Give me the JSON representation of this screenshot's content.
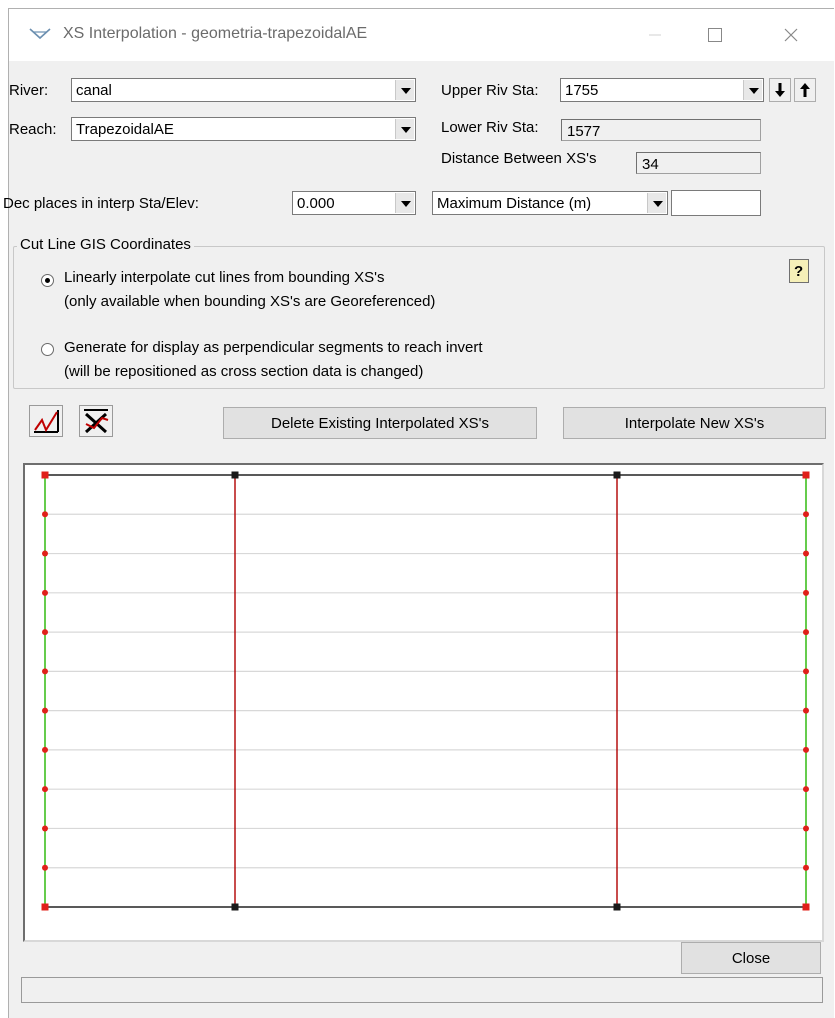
{
  "window": {
    "title": "XS Interpolation  - geometria-trapezoidalAE"
  },
  "river": {
    "label": "River:",
    "value": "canal"
  },
  "reach": {
    "label": "Reach:",
    "value": "TrapezoidalAE"
  },
  "upper_riv_sta": {
    "label": "Upper Riv Sta:",
    "value": "1755"
  },
  "lower_riv_sta": {
    "label": "Lower Riv Sta:",
    "value": "1577"
  },
  "distance_between": {
    "label": "Distance Between XS's",
    "value": "34"
  },
  "dec_places": {
    "label": "Dec places in interp Sta/Elev:",
    "value": "0.000"
  },
  "max_distance": {
    "selected": "Maximum Distance (m)",
    "value": ""
  },
  "cutline_group": {
    "legend": "Cut Line GIS Coordinates",
    "option1_line1": "Linearly interpolate cut lines from bounding XS's",
    "option1_line2": "(only available when bounding XS's are Georeferenced)",
    "option2_line1": "Generate for display as perpendicular segments to reach invert",
    "option2_line2": "(will be repositioned as cross section data is changed)",
    "selected_option": 1
  },
  "buttons": {
    "delete_existing": "Delete Existing Interpolated XS's",
    "interpolate_new": "Interpolate New XS's",
    "close": "Close"
  },
  "icons": {
    "help": "help-icon",
    "draw_line": "draw-line-icon",
    "delete_line": "delete-line-icon",
    "down": "arrow-down-icon",
    "up": "arrow-up-icon"
  },
  "colors": {
    "bank_line": "#3fbf1f",
    "channel_line": "#b00000",
    "node_red": "#e0201a",
    "node_black": "#1a1a1a",
    "xs_line": "#d8d8d8"
  },
  "plot": {
    "interpolated_xs_count": 10
  }
}
